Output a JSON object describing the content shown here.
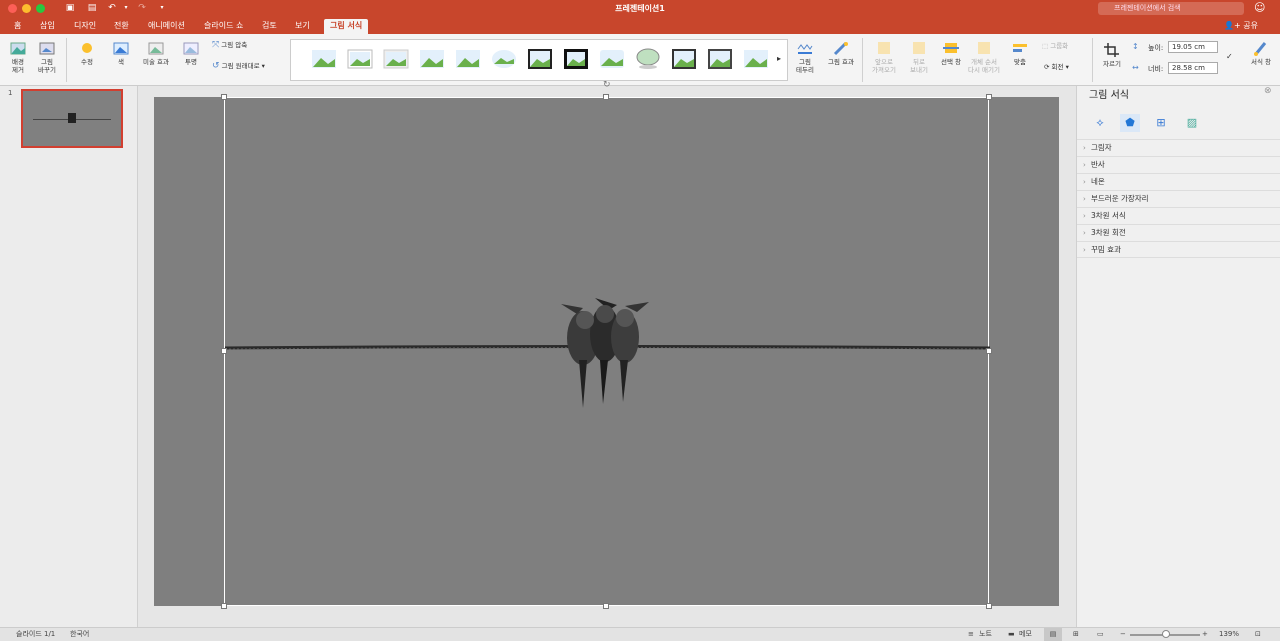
{
  "window": {
    "title": "프레젠테이션1",
    "search_placeholder": "프레젠테이션에서 검색"
  },
  "tabs": [
    {
      "label": "홈"
    },
    {
      "label": "삽입"
    },
    {
      "label": "디자인"
    },
    {
      "label": "전환"
    },
    {
      "label": "애니메이션"
    },
    {
      "label": "슬라이드 쇼"
    },
    {
      "label": "검토"
    },
    {
      "label": "보기"
    },
    {
      "label": "그림 서식",
      "active": true
    }
  ],
  "share_label": "공유",
  "ribbon": {
    "remove_bg": "배경\n제거",
    "change_picture": "그림\n바꾸기",
    "corrections": "수정",
    "color": "색",
    "artistic": "미술 효과",
    "transparency": "투명",
    "compress": "그림 압축",
    "reset": "그림 원래대로",
    "border": "그림\n테두리",
    "effects": "그림 효과",
    "bring_forward": "앞으로\n가져오기",
    "send_backward": "뒤로\n보내기",
    "selection_pane": "선택 창",
    "reorder": "개체 순서\n다시 매기기",
    "align": "맞춤",
    "group": "그룹화",
    "rotate": "회전",
    "crop": "자르기",
    "height_label": "높이:",
    "height_value": "19.05 cm",
    "width_label": "너비:",
    "width_value": "28.58 cm",
    "format_pane": "서식 창"
  },
  "slides": [
    {
      "number": "1"
    }
  ],
  "pane": {
    "title": "그림 서식",
    "sections": [
      "그림자",
      "반사",
      "네온",
      "부드러운 가장자리",
      "3차원 서식",
      "3차원 회전",
      "꾸밈 효과"
    ]
  },
  "status": {
    "slide": "슬라이드 1/1",
    "language": "한국어",
    "notes": "노트",
    "comments": "메모",
    "zoom": "139%"
  },
  "colors": {
    "accent": "#c8462c",
    "slide_bg": "#7f7f7f"
  }
}
